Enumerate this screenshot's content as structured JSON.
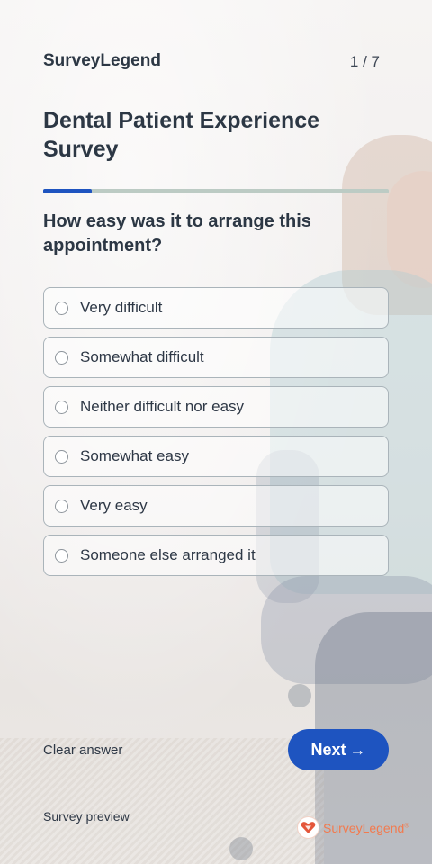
{
  "header": {
    "brand": "SurveyLegend",
    "counter": "1 / 7"
  },
  "survey": {
    "title": "Dental Patient Experience Survey",
    "progress": 0.14
  },
  "question": {
    "text": "How easy was it to arrange this appointment?",
    "options": [
      {
        "label": "Very difficult",
        "selected": false
      },
      {
        "label": "Somewhat difficult",
        "selected": false
      },
      {
        "label": "Neither difficult nor easy",
        "selected": false
      },
      {
        "label": "Somewhat easy",
        "selected": false
      },
      {
        "label": "Very easy",
        "selected": false
      },
      {
        "label": "Someone else arranged it",
        "selected": false
      }
    ]
  },
  "actions": {
    "clear_label": "Clear answer",
    "next_label": "Next",
    "next_arrow": "→"
  },
  "footer": {
    "preview_label": "Survey preview",
    "logo_text": "SurveyLegend",
    "logo_mark": "®"
  },
  "colors": {
    "accent": "#1e54c0",
    "progress_track": "#bccbc4",
    "logo": "#f27a4e"
  },
  "icons": {
    "logo": "heart-badge-icon",
    "next": "arrow-right-icon"
  }
}
